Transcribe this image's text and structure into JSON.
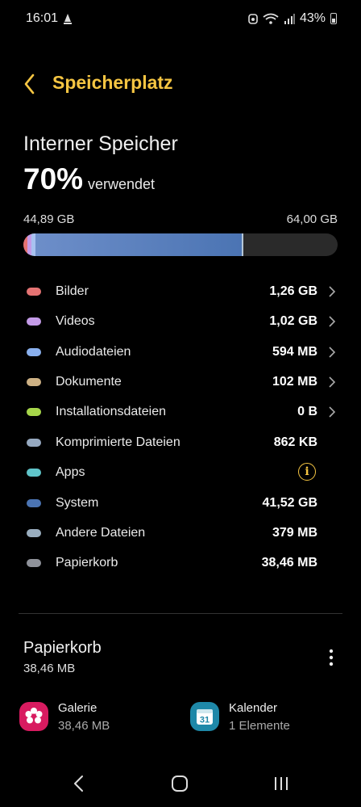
{
  "status_bar": {
    "time": "16:01",
    "battery": "43%"
  },
  "header": {
    "title": "Speicherplatz"
  },
  "storage": {
    "heading": "Interner Speicher",
    "percent": "70%",
    "used_label": "verwendet",
    "used_amount": "44,89 GB",
    "total": "64,00 GB",
    "used_fraction": 0.7
  },
  "categories": [
    {
      "label": "Bilder",
      "value": "1,26 GB",
      "color": "#e57373",
      "action": "chevron"
    },
    {
      "label": "Videos",
      "value": "1,02 GB",
      "color": "#c49be8",
      "action": "chevron"
    },
    {
      "label": "Audiodateien",
      "value": "594 MB",
      "color": "#8ab0ee",
      "action": "chevron"
    },
    {
      "label": "Dokumente",
      "value": "102 MB",
      "color": "#cdb184",
      "action": "chevron"
    },
    {
      "label": "Installationsdateien",
      "value": "0 B",
      "color": "#a6d64a",
      "action": "chevron"
    },
    {
      "label": "Komprimierte Dateien",
      "value": "862 KB",
      "color": "#96a9c0",
      "action": "none"
    },
    {
      "label": "Apps",
      "value": "",
      "color": "#5fc4c9",
      "action": "info"
    },
    {
      "label": "System",
      "value": "41,52 GB",
      "color": "#4b74b3",
      "action": "none"
    },
    {
      "label": "Andere Dateien",
      "value": "379 MB",
      "color": "#9aaebf",
      "action": "none"
    },
    {
      "label": "Papierkorb",
      "value": "38,46 MB",
      "color": "#8f929a",
      "action": "none"
    }
  ],
  "trash": {
    "title": "Papierkorb",
    "size": "38,46 MB",
    "apps": [
      {
        "name": "Galerie",
        "detail": "38,46 MB",
        "icon": "gallery-flower-icon",
        "color": "#d81b60"
      },
      {
        "name": "Kalender",
        "detail": "1 Elemente",
        "icon": "calendar-icon",
        "color": "#1e88a8",
        "day": "31"
      }
    ]
  },
  "icons": {
    "back": "chevron-left-icon",
    "more": "more-vertical-icon",
    "info": "info-icon",
    "nav_back": "nav-back-icon",
    "nav_home": "nav-home-icon",
    "nav_recent": "nav-recents-icon"
  }
}
